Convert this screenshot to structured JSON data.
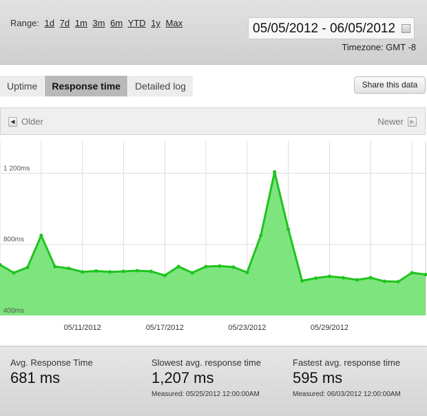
{
  "range": {
    "label": "Range:",
    "options": [
      "1d",
      "7d",
      "1m",
      "3m",
      "6m",
      "YTD",
      "1y",
      "Max"
    ]
  },
  "date_range": "05/05/2012 - 06/05/2012",
  "timezone": "Timezone: GMT -8",
  "tabs": [
    {
      "label": "Uptime",
      "active": false
    },
    {
      "label": "Response time",
      "active": true
    },
    {
      "label": "Detailed log",
      "active": false
    }
  ],
  "share_label": "Share this data",
  "nav": {
    "older": "Older",
    "newer": "Newer"
  },
  "colors": {
    "line": "#1ec41e",
    "fill": "#7ee47e",
    "grid": "#dddddd"
  },
  "chart_data": {
    "type": "area",
    "x_tick_labels": [
      "05/11/2012",
      "05/17/2012",
      "05/23/2012",
      "05/29/2012"
    ],
    "x_tick_positions": [
      6,
      12,
      18,
      24
    ],
    "y_tick_labels": [
      "1 200ms",
      "800ms",
      "400ms"
    ],
    "y_tick_values": [
      1200,
      800,
      400
    ],
    "ylim": [
      400,
      1380
    ],
    "x": [
      0,
      1,
      2,
      3,
      4,
      5,
      6,
      7,
      8,
      9,
      10,
      11,
      12,
      13,
      14,
      15,
      16,
      17,
      18,
      19,
      20,
      21,
      22,
      23,
      24,
      25,
      26,
      27,
      28,
      29,
      30,
      31
    ],
    "values": [
      685,
      640,
      670,
      850,
      675,
      665,
      645,
      650,
      645,
      648,
      652,
      648,
      625,
      675,
      640,
      675,
      678,
      672,
      642,
      850,
      1207,
      885,
      595,
      610,
      620,
      612,
      600,
      612,
      592,
      590,
      640,
      630
    ],
    "grid": true
  },
  "stats": [
    {
      "title": "Avg. Response Time",
      "value": "681 ms",
      "measured": ""
    },
    {
      "title": "Slowest avg. response time",
      "value": "1,207 ms",
      "measured": "Measured: 05/25/2012 12:00:00AM"
    },
    {
      "title": "Fastest avg. response time",
      "value": "595 ms",
      "measured": "Measured: 06/03/2012 12:00:00AM"
    }
  ]
}
